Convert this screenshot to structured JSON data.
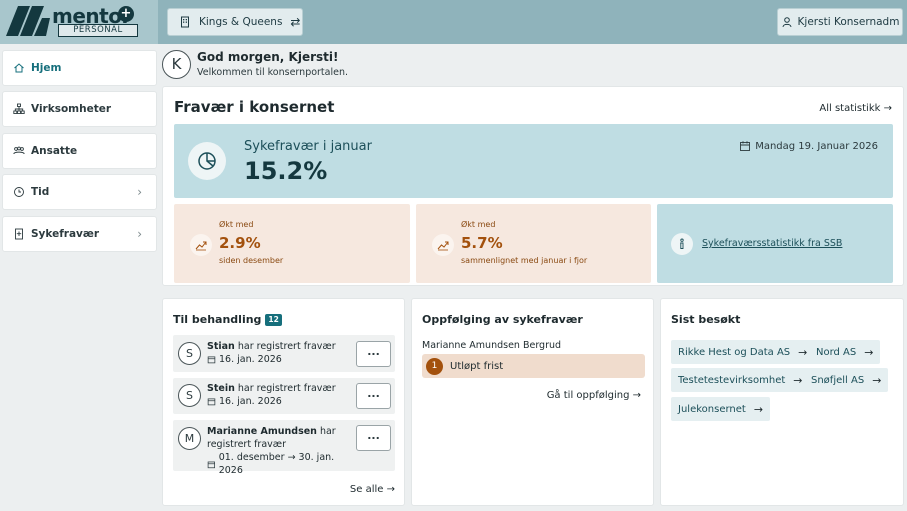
{
  "brand": {
    "name": "mentor",
    "suffix": "PERSONAL"
  },
  "header": {
    "org_button": {
      "label": "Kings & Queens",
      "icon": "building-icon",
      "swap_icon": "swap-icon"
    },
    "user_button": {
      "label": "Kjersti Konsernadm",
      "icon": "user-icon"
    }
  },
  "sidebar": {
    "items": [
      {
        "label": "Hjem",
        "icon": "home-icon",
        "active": true
      },
      {
        "label": "Virksomheter",
        "icon": "org-chart-icon"
      },
      {
        "label": "Ansatte",
        "icon": "people-icon"
      },
      {
        "label": "Tid",
        "icon": "clock-icon",
        "chevron": "›"
      },
      {
        "label": "Sykefravær",
        "icon": "document-icon",
        "chevron": "›"
      }
    ]
  },
  "greeting": {
    "initial": "K",
    "title": "God morgen, Kjersti!",
    "subtitle": "Velkommen til konsernportalen."
  },
  "absence": {
    "title": "Fravær i konsernet",
    "all_stats_link": "All statistikk",
    "hero": {
      "label": "Sykefravær i januar",
      "value": "15.2%",
      "date": "Mandag 19. Januar 2026"
    },
    "stats": [
      {
        "pre": "Økt med",
        "value": "2.9%",
        "post": "siden desember"
      },
      {
        "pre": "Økt med",
        "value": "5.7%",
        "post": "sammenlignet med januar i fjor"
      }
    ],
    "ssb_link": "Sykefraværsstatistikk fra SSB"
  },
  "tasks": {
    "title": "Til behandling",
    "count": "12",
    "items": [
      {
        "initial": "S",
        "name": "Stian",
        "text": " har registrert fravær",
        "date": "16. jan. 2026"
      },
      {
        "initial": "S",
        "name": "Stein",
        "text": " har registrert fravær",
        "date": "16. jan. 2026"
      },
      {
        "initial": "M",
        "name": "Marianne Amundsen",
        "text": " har registrert fravær",
        "date": "01. desember → 30. jan. 2026"
      }
    ],
    "more_label": "...",
    "see_all": "Se alle →"
  },
  "followup": {
    "title": "Oppfølging av sykefravær",
    "person": "Marianne Amundsen Bergrud",
    "status_num": "1",
    "status": "Utløpt frist",
    "link": "Gå til oppfølging →"
  },
  "recent": {
    "title": "Sist besøkt",
    "items": [
      "Rikke Hest og Data AS",
      "Nord AS",
      "Testetestevirksomhet",
      "Snøfjell AS",
      "Julekonsernet"
    ]
  },
  "colors": {
    "accent": "#166f7c",
    "hero_bg": "#bfdde3",
    "warn_bg": "#f6e8df",
    "warn_text": "#a3510d"
  }
}
